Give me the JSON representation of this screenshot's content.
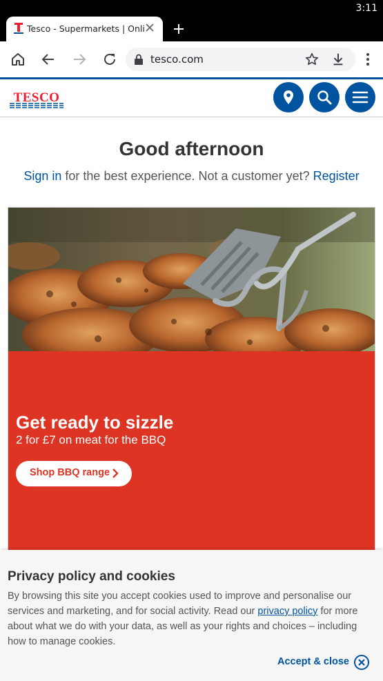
{
  "status_bar": {
    "time": "3:11"
  },
  "browser": {
    "tab_title": "Tesco - Supermarkets | Online Groceries",
    "url": "tesco.com"
  },
  "site": {
    "logo_text": "TESCO",
    "greeting": "Good afternoon",
    "signin_link": "Sign in",
    "signin_middle": " for the best experience. Not a customer yet? ",
    "register_link": "Register"
  },
  "promo": {
    "headline": "Get ready to sizzle",
    "subtitle": "2 for £7 on meat for the BBQ",
    "cta": "Shop BBQ range"
  },
  "cookie_banner": {
    "title": "Privacy policy and cookies",
    "text_before": "By browsing this site you accept cookies used to improve and personalise our services and marketing, and for social activity. Read our ",
    "link": "privacy policy",
    "text_after": " for more about what we do with your data, as well as your rights and choices – including how to manage cookies.",
    "accept": "Accept & close"
  },
  "colors": {
    "brand_blue": "#00539f",
    "brand_red": "#ee1c2e",
    "promo_red": "#dd3424"
  }
}
